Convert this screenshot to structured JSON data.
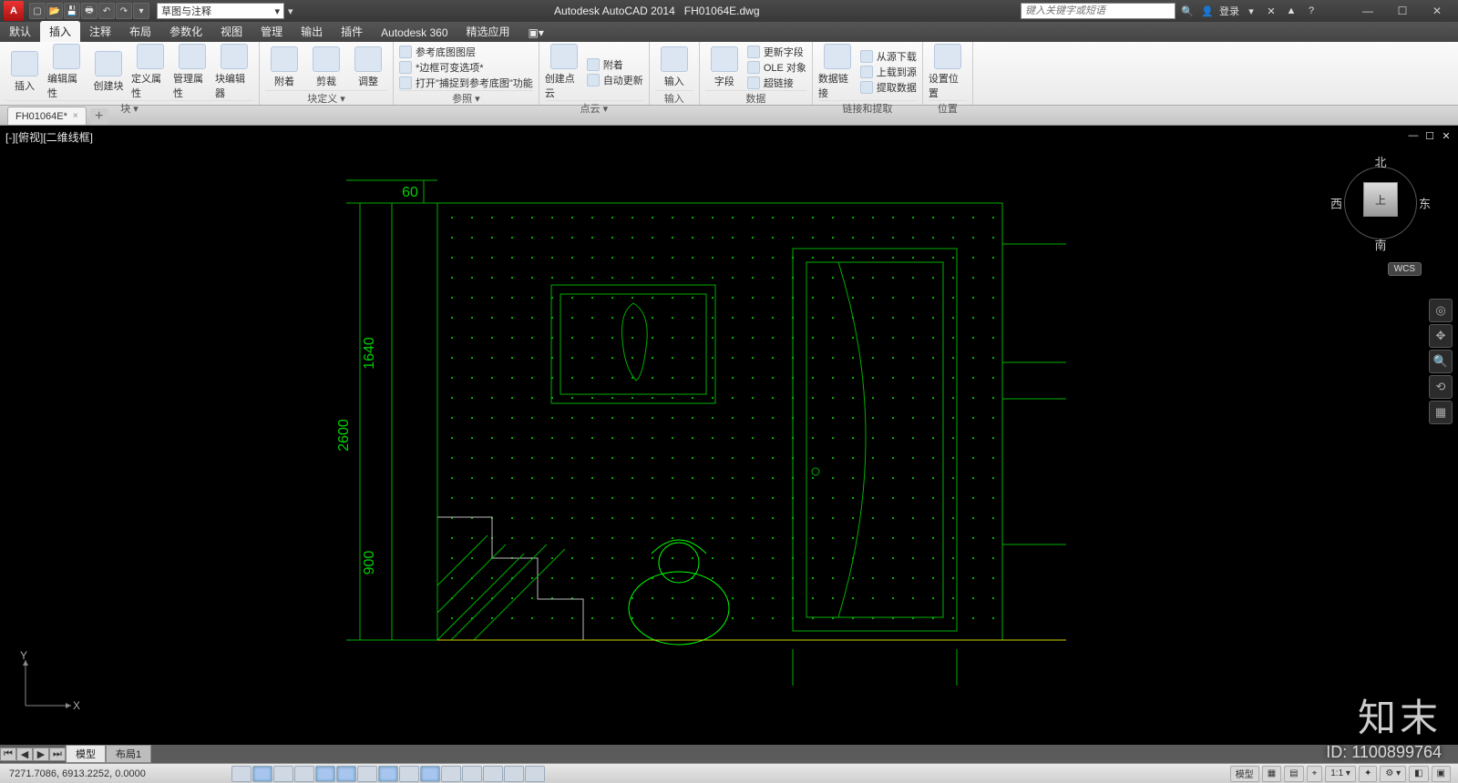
{
  "titlebar": {
    "app_title": "Autodesk AutoCAD 2014",
    "doc_name": "FH01064E.dwg",
    "workspace": "草图与注释",
    "search_placeholder": "键入关键字或短语",
    "login_label": "登录",
    "qat": [
      "new",
      "open",
      "save",
      "print",
      "undo",
      "redo"
    ]
  },
  "ribbon_tabs": [
    "默认",
    "插入",
    "注释",
    "布局",
    "参数化",
    "视图",
    "管理",
    "输出",
    "插件",
    "Autodesk 360",
    "精选应用"
  ],
  "ribbon_active_index": 1,
  "ribbon": {
    "panels": [
      {
        "title": "块 ▾",
        "big": [
          {
            "label": "插入"
          },
          {
            "label": "编辑属性"
          },
          {
            "label": "创建块"
          },
          {
            "label": "定义属性"
          },
          {
            "label": "管理属性"
          },
          {
            "label": "块编辑器"
          }
        ]
      },
      {
        "title": "块定义 ▾",
        "big": [
          {
            "label": "附着"
          },
          {
            "label": "剪裁"
          },
          {
            "label": "调整"
          }
        ]
      },
      {
        "title": "参照 ▾",
        "small": [
          "参考底图图层",
          "*边框可变选项*",
          "打开\"捕捉到参考底图\"功能"
        ]
      },
      {
        "title": "点云 ▾",
        "big": [
          {
            "label": "创建点云"
          }
        ],
        "small": [
          "附着",
          "自动更新"
        ]
      },
      {
        "title": "输入",
        "big": [
          {
            "label": "输入"
          }
        ]
      },
      {
        "title": "数据",
        "big": [
          {
            "label": "字段"
          }
        ],
        "small": [
          "更新字段",
          "OLE 对象",
          "超链接"
        ]
      },
      {
        "title": "链接和提取",
        "big": [
          {
            "label": "数据链接"
          }
        ],
        "small": [
          "从源下载",
          "上载到源",
          "提取数据"
        ]
      },
      {
        "title": "位置",
        "big": [
          {
            "label": "设置位置"
          }
        ]
      }
    ]
  },
  "filetab": {
    "name": "FH01064E*",
    "close": "×"
  },
  "viewport": {
    "label": "[-][俯视][二维线框]",
    "viewcube": {
      "north": "北",
      "south": "南",
      "east": "东",
      "west": "西",
      "top": "上"
    },
    "wcs": "WCS",
    "ucs": {
      "x": "X",
      "y": "Y"
    },
    "dimensions": {
      "d1": "60",
      "d2": "1640",
      "d3": "2600",
      "d4": "900"
    }
  },
  "layout_tabs": {
    "model": "模型",
    "layout1": "布局1"
  },
  "statusbar": {
    "coords": "7271.7086, 6913.2252, 0.0000",
    "right": [
      "模型",
      "▦",
      "▤",
      "⌖",
      "1:1 ▾",
      "✦",
      "⚙ ▾",
      "◧",
      "▣"
    ]
  },
  "watermark": {
    "brand": "知末",
    "id": "ID: 1100899764"
  },
  "icons": {
    "triangle_down": "▾"
  }
}
